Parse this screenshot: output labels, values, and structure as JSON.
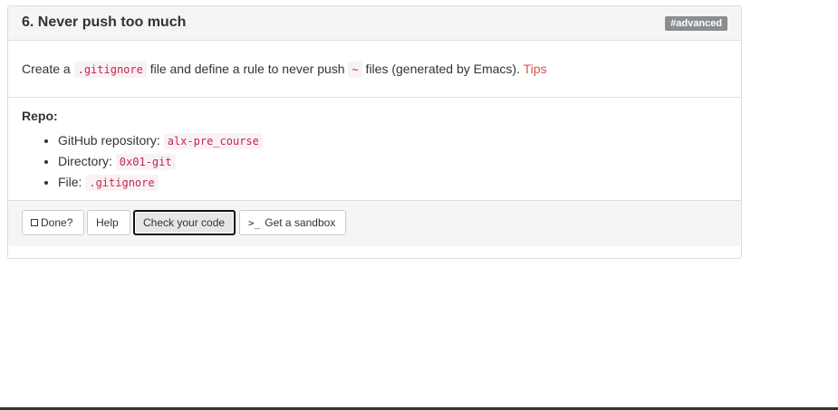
{
  "task": {
    "title": "6. Never push too much",
    "badge": "#advanced",
    "description_prefix": "Create a ",
    "code_filename": ".gitignore",
    "description_middle": " file and define a rule to never push ",
    "code_tilde": "~",
    "description_suffix": " files (generated by Emacs). ",
    "tips_link": "Tips"
  },
  "repo": {
    "heading": "Repo:",
    "items": [
      {
        "label": "GitHub repository: ",
        "value": "alx-pre_course"
      },
      {
        "label": "Directory: ",
        "value": "0x01-git"
      },
      {
        "label": "File: ",
        "value": ".gitignore"
      }
    ]
  },
  "actions": {
    "done_label": "Done?",
    "help_label": "Help",
    "check_label": "Check your code",
    "sandbox_icon": ">_",
    "sandbox_label": "Get a sandbox"
  }
}
